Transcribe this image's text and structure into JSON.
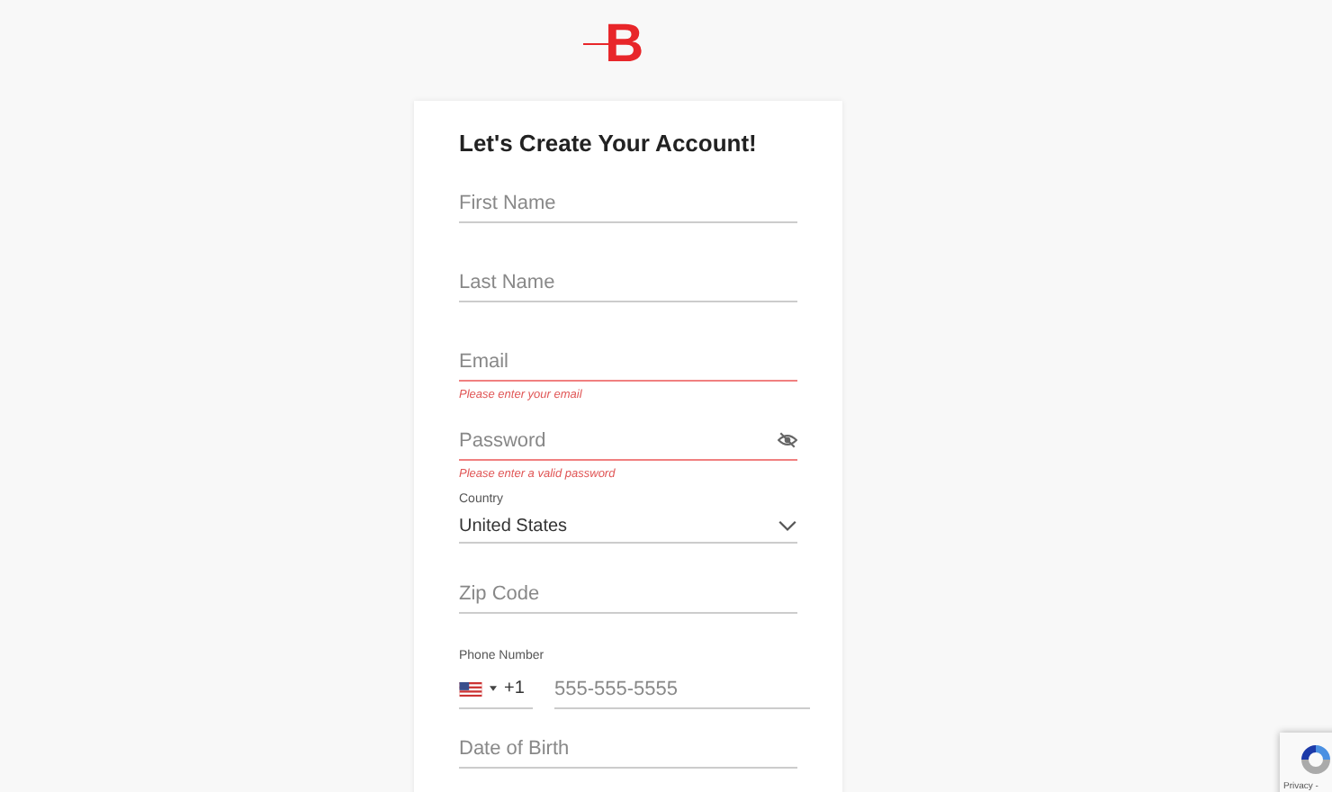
{
  "logo": {
    "text": "B"
  },
  "form": {
    "title": "Let's Create Your Account!",
    "fields": [
      {
        "kind": "text",
        "placeholder": "First Name"
      },
      {
        "kind": "text",
        "placeholder": "Last Name"
      },
      {
        "kind": "text",
        "placeholder": "Email",
        "error": "Please enter your email"
      },
      {
        "kind": "password",
        "placeholder": "Password",
        "error": "Please enter a valid password"
      },
      {
        "kind": "select",
        "label": "Country",
        "value": "United States"
      },
      {
        "kind": "text",
        "placeholder": "Zip Code"
      },
      {
        "kind": "phone",
        "label": "Phone Number",
        "code": "+1",
        "placeholder": "555-555-5555"
      },
      {
        "kind": "text",
        "placeholder": "Date of Birth"
      }
    ]
  },
  "recaptcha": {
    "text": "Privacy -"
  }
}
